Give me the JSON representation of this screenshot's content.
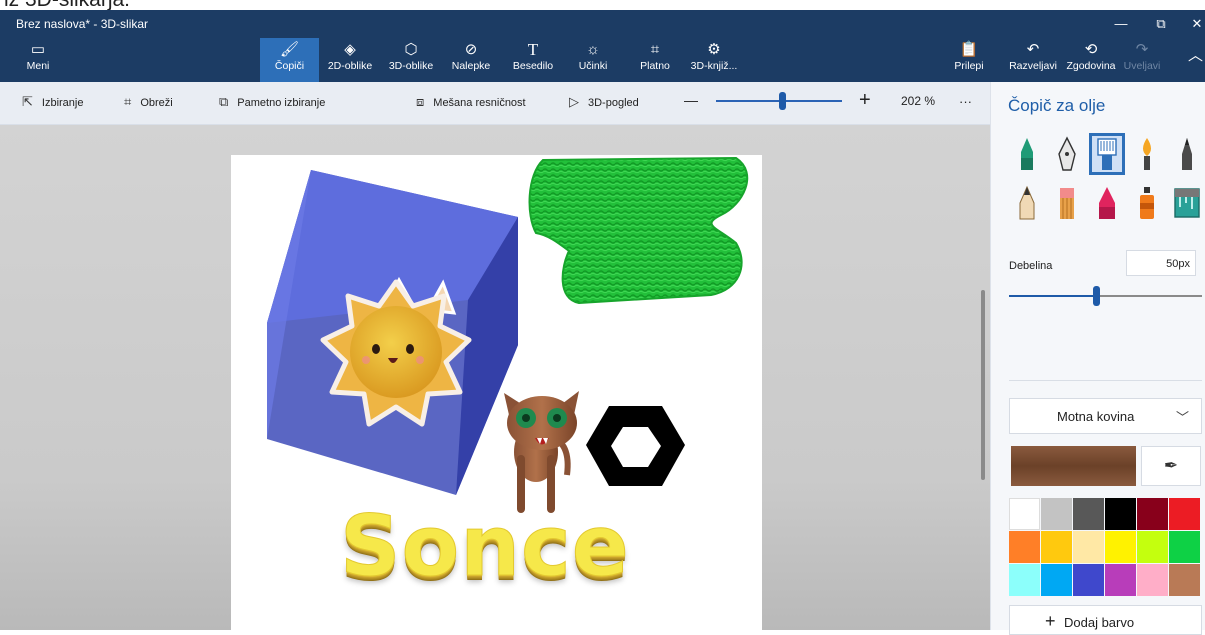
{
  "top_fragment": "iz 3D-slikarja:",
  "window": {
    "title": "Brez naslova* - 3D-slikar",
    "minimize": "—",
    "restore": "⧉",
    "close": "✕"
  },
  "ribbon": {
    "menu": {
      "label": "Meni",
      "icon": "menu-icon"
    },
    "tools": [
      {
        "label": "Čopiči",
        "icon": "brush-icon",
        "active": true
      },
      {
        "label": "2D-oblike",
        "icon": "2d-shapes-icon"
      },
      {
        "label": "3D-oblike",
        "icon": "3d-shapes-icon"
      },
      {
        "label": "Nalepke",
        "icon": "stickers-icon"
      },
      {
        "label": "Besedilo",
        "icon": "text-icon"
      },
      {
        "label": "Učinki",
        "icon": "effects-icon"
      },
      {
        "label": "Platno",
        "icon": "canvas-icon"
      },
      {
        "label": "3D-knjiž...",
        "icon": "3d-library-icon"
      }
    ],
    "paste": "Prilepi",
    "undo": "Razveljavi",
    "history": "Zgodovina",
    "redo": "Uveljavi"
  },
  "toolbar": {
    "select": "Izbiranje",
    "crop": "Obreži",
    "magic_select": "Pametno izbiranje",
    "mixed_reality": "Mešana resničnost",
    "view_3d": "3D-pogled",
    "zoom_out": "—",
    "zoom_in": "+",
    "zoom_value": "202 %",
    "more": "···"
  },
  "panel": {
    "title": "Čopič za olje",
    "brushes": [
      "marker",
      "calligraphy-pen",
      "oil-brush",
      "watercolor",
      "pencil",
      "crayon",
      "eraser",
      "pixel-pen",
      "spray-can",
      "fill-bucket"
    ],
    "selected_brush": "oil-brush",
    "thickness_label": "Debelina",
    "thickness_value": "50px",
    "thickness_level": 0.45,
    "finish": "Motna kovina",
    "current_color": "#6b4128",
    "palette": [
      "#ffffff",
      "#c3c3c3",
      "#585858",
      "#000000",
      "#88001b",
      "#ec1c24",
      "#ff7f27",
      "#ffc90e",
      "#ffe8a5",
      "#fff200",
      "#c4ff0e",
      "#0ed145",
      "#8cfffb",
      "#00a8f3",
      "#3f48cc",
      "#b83dba",
      "#ffaec8",
      "#b97a56"
    ],
    "add_color": "Dodaj barvo"
  },
  "canvas": {
    "text_object": "Sonce"
  }
}
